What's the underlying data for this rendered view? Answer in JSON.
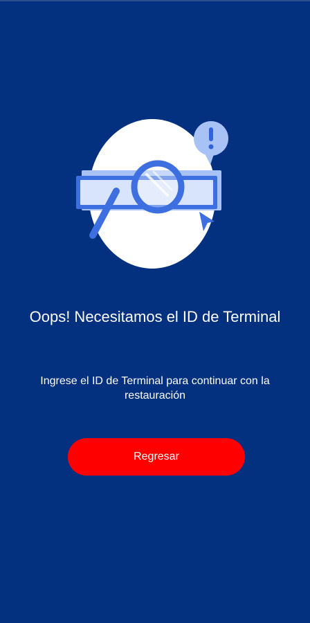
{
  "screen": {
    "title": "Oops! Necesitamos el ID de Terminal",
    "message": "Ingrese el ID de Terminal para continuar con la restauración",
    "back_button_label": "Regresar"
  },
  "illustration": {
    "icon": "search-id-alert-illustration"
  },
  "colors": {
    "background": "#03307f",
    "button": "#ff0000",
    "accent": "#3d6fe0",
    "text": "#ffffff"
  }
}
